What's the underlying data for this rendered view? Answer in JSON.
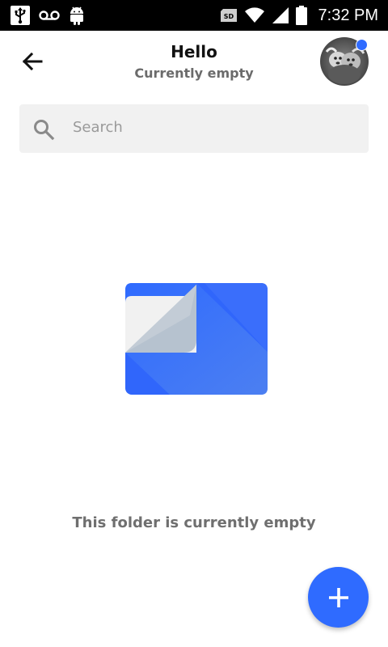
{
  "status_bar": {
    "time": "7:32 PM",
    "sd_label": "SD",
    "icons": [
      "usb-icon",
      "voicemail-icon",
      "android-icon",
      "sd-card-icon",
      "wifi-icon",
      "signal-icon",
      "battery-icon"
    ]
  },
  "header": {
    "title": "Hello",
    "subtitle": "Currently empty",
    "back_icon": "arrow-back-icon",
    "avatar_badge_color": "#2f6bff"
  },
  "search": {
    "placeholder": "Search",
    "icon": "search-icon"
  },
  "empty_state": {
    "message": "This folder is currently empty",
    "illustration": "empty-folder-page-icon"
  },
  "fab": {
    "icon": "plus-icon",
    "color": "#2f6bff"
  },
  "colors": {
    "accent": "#2f6bff",
    "status_bar": "#000000",
    "search_bg": "#f1f1f1"
  }
}
